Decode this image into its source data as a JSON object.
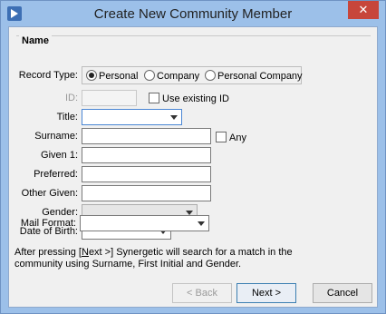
{
  "window": {
    "title": "Create New Community Member",
    "close_glyph": "✕"
  },
  "group": {
    "label": "Name"
  },
  "record_type": {
    "label": "Record Type:",
    "options": [
      {
        "label": "Personal",
        "checked": true
      },
      {
        "label": "Company",
        "checked": false
      },
      {
        "label": "Personal Company",
        "checked": false
      }
    ]
  },
  "id_field": {
    "label": "ID:",
    "value": "",
    "use_existing_label": "Use existing ID",
    "use_existing_checked": false
  },
  "title_field": {
    "label": "Title:",
    "value": ""
  },
  "surname": {
    "label": "Surname:",
    "value": "",
    "any_label": "Any",
    "any_checked": false
  },
  "given1": {
    "label": "Given 1:",
    "value": ""
  },
  "preferred": {
    "label": "Preferred:",
    "value": ""
  },
  "other_given": {
    "label": "Other Given:",
    "value": ""
  },
  "gender": {
    "label": "Gender:",
    "value": ""
  },
  "dob": {
    "label": "Date of Birth:",
    "value": ""
  },
  "mail_format": {
    "label": "Mail Format:",
    "value": ""
  },
  "info": {
    "prefix": "After pressing [",
    "next_key": "N",
    "suffix_line1": "ext >] Synergetic will search for a match in the",
    "line2": "community using Surname, First Initial and Gender."
  },
  "buttons": {
    "back": "< Back",
    "next": "Next >",
    "cancel": "Cancel"
  },
  "icons": {
    "app": "app-icon",
    "close": "close-icon",
    "dropdown": "chevron-down-icon"
  }
}
